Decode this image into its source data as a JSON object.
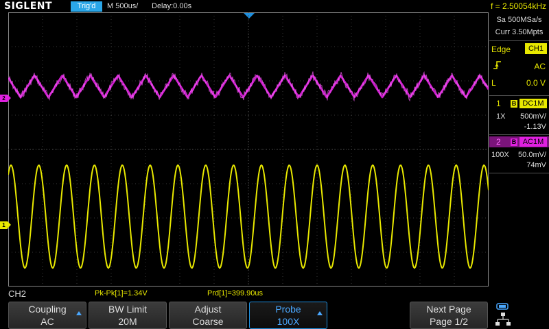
{
  "header": {
    "brand": "SIGLENT",
    "trigger_status": "Trig'd",
    "timebase": "M 500us/",
    "delay": "Delay:0.00s",
    "frequency": "f = 2.50054kHz"
  },
  "acquisition": {
    "sample_rate": "Sa 500MSa/s",
    "memory_depth": "Curr 3.50Mpts"
  },
  "trigger": {
    "type": "Edge",
    "source": "CH1",
    "coupling": "AC",
    "level_label": "L",
    "level": "0.0 V",
    "slope_icon": "rising-edge-icon"
  },
  "channels": [
    {
      "number": "1",
      "bw": "B",
      "coupling": "DC1M",
      "probe": "1X",
      "scale": "500mV/",
      "offset": "-1.13V",
      "color": "#e8e800"
    },
    {
      "number": "2",
      "bw": "B",
      "coupling": "AC1M",
      "probe": "100X",
      "scale": "50.0mV/",
      "offset": "74mV",
      "color": "#e020e0"
    }
  ],
  "markers": {
    "ch1": "1",
    "ch2": "2"
  },
  "measurements": {
    "menu_title": "CH2",
    "pk_pk": "Pk-Pk[1]=1.34V",
    "period": "Prd[1]=399.90us"
  },
  "softkeys": [
    {
      "line1": "Coupling",
      "line2": "AC",
      "active": false,
      "has_arrow": true
    },
    {
      "line1": "BW Limit",
      "line2": "20M",
      "active": false,
      "has_arrow": false
    },
    {
      "line1": "Adjust",
      "line2": "Coarse",
      "active": false,
      "has_arrow": false
    },
    {
      "line1": "Probe",
      "line2": "100X",
      "active": true,
      "has_arrow": true
    },
    {
      "line1": "Next Page",
      "line2": "Page 1/2",
      "active": false,
      "has_arrow": false
    }
  ],
  "status_icons": [
    "usb-icon",
    "network-icon"
  ]
}
